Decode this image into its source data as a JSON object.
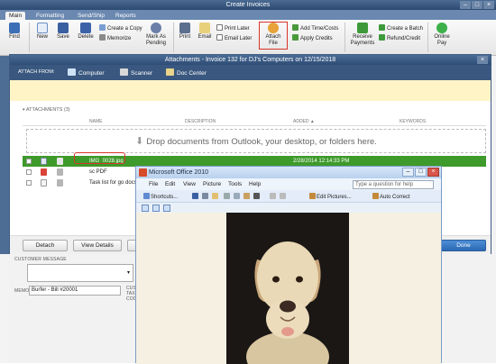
{
  "create_invoices": {
    "title": "Create Invoices",
    "tabs": [
      "Main",
      "Formatting",
      "Send/Ship",
      "Reports"
    ],
    "toolbar": {
      "find": "Find",
      "new": "New",
      "save": "Save",
      "delete": "Delete",
      "create_copy": "Create a Copy",
      "memorize": "Memorize",
      "mark_pending": "Mark As Pending",
      "print": "Print",
      "email": "Email",
      "print_later": "Print Later",
      "email_later": "Email Later",
      "attach_file": "Attach File",
      "add_time_costs": "Add Time/Costs",
      "apply_credits": "Apply Credits",
      "receive_payments": "Receive Payments",
      "create_batch": "Create a Batch",
      "refund_credit": "Refund/Credit",
      "online_pay": "Online Pay"
    },
    "customer_message_label": "CUSTOMER MESSAGE",
    "memo_label": "MEMO",
    "memo_value": "Burfer - Bill #20001",
    "customer_tax_label": "CUSTOM TAX COD"
  },
  "attachments": {
    "title": "Attachments - Invoice 132 for DJ's Computers on 12/15/2018",
    "attach_from_label": "ATTACH FROM:",
    "sources": [
      "Computer",
      "Scanner",
      "Doc Center"
    ],
    "section_label": "ATTACHMENTS (3)",
    "columns": [
      "NAME",
      "DESCRIPTION",
      "ADDED ▲",
      "KEYWORDS"
    ],
    "drop_text": "Drop documents from Outlook, your desktop, or folders here.",
    "rows": [
      {
        "name": "IMG_0028.jpg",
        "added": "2/28/2014 12:14:33 PM"
      },
      {
        "name": "sc PDF",
        "added": ""
      },
      {
        "name": "Task list for go docs",
        "added": ""
      }
    ],
    "buttons": {
      "detach": "Detach",
      "view_details": "View Details",
      "done": "Done"
    }
  },
  "office": {
    "title": "Microsoft Office 2010",
    "menus": [
      "File",
      "Edit",
      "View",
      "Picture",
      "Tools",
      "Help"
    ],
    "help_placeholder": "Type a question for help",
    "toolbar": {
      "shortcuts": "Shortcuts...",
      "edit_pictures": "Edit Pictures...",
      "auto_correct": "Auto Correct"
    }
  },
  "colors": {
    "selected_row": "#3e9a2a",
    "highlight": "#d9342b",
    "title_bar": "#2e4d76",
    "done_button": "#2a68b3"
  }
}
